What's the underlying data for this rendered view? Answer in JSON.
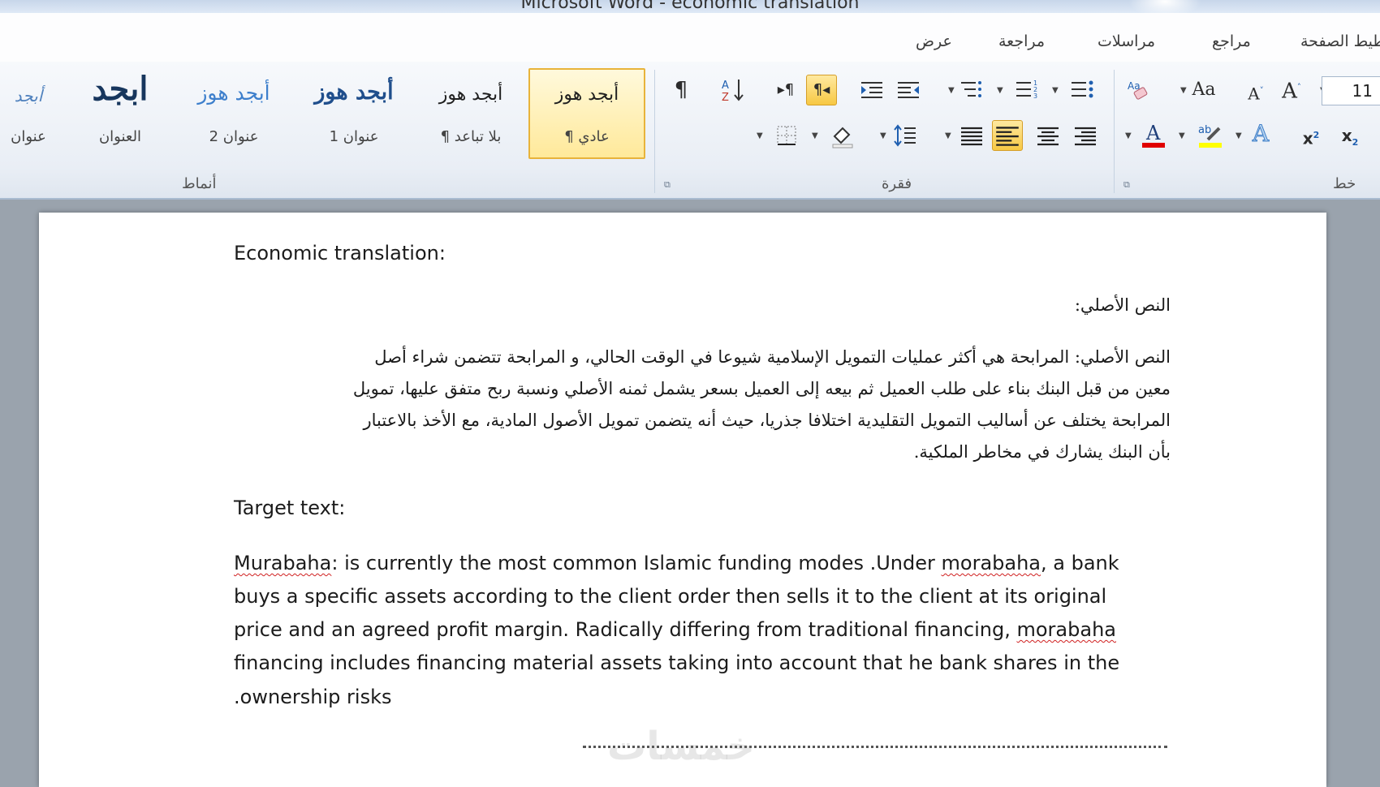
{
  "window": {
    "title": "Microsoft Word  -  economic translation"
  },
  "tabs": [
    "عرض",
    "مراجعة",
    "مراسلات",
    "مراجع",
    "تخطيط الصفحة"
  ],
  "ribbon": {
    "styles_group": {
      "label": "أنماط",
      "tiles": [
        {
          "sample": "أبجد هوز",
          "name": "¶ عادي"
        },
        {
          "sample": "أبجد هوز",
          "name": "¶ بلا تباعد"
        },
        {
          "sample": "أبجد هوز",
          "name": "عنوان 1"
        },
        {
          "sample": "أبجد هوز",
          "name": "عنوان 2"
        },
        {
          "sample": "ابجد",
          "name": "العنوان"
        },
        {
          "sample": "أبجد",
          "name": "عنوان"
        }
      ]
    },
    "paragraph_group": {
      "label": "فقرة"
    },
    "font_group": {
      "label": "خط",
      "font_size": "11"
    }
  },
  "document": {
    "heading": "Economic translation:",
    "source_label": "النص الأصلي:",
    "source_lines": [
      "النص الأصلي: المرابحة هي أكثر عمليات التمويل الإسلامية شيوعا في الوقت الحالي، و المرابحة تتضمن شراء أصل",
      "معين من قبل البنك بناء على طلب العميل ثم بيعه إلى العميل بسعر يشمل ثمنه الأصلي ونسبة ربح متفق عليها، تمويل",
      "المرابحة يختلف عن أساليب التمويل التقليدية اختلافا جذريا، حيث أنه يتضمن تمويل الأصول المادية، مع الأخذ بالاعتبار",
      "بأن  البنك يشارك في مخاطر الملكية."
    ],
    "target_label": "Target text:",
    "target_lines": [
      {
        "pre": "",
        "sq": "Murabaha",
        "post": ": is  currently the most common Islamic funding modes .Under ",
        "sq2": "morabaha",
        "post2": ", a bank"
      },
      {
        "pre": "buys a specific assets according to the client  order then sells it to the client at its original",
        "sq": "",
        "post": "",
        "sq2": "",
        "post2": ""
      },
      {
        "pre": "price and an agreed profit margin. Radically  differing from traditional  financing, ",
        "sq": "morabaha",
        "post": "",
        "sq2": "",
        "post2": ""
      },
      {
        "pre": "financing includes financing material assets taking into account that he bank shares in  the",
        "sq": "",
        "post": "",
        "sq2": "",
        "post2": ""
      },
      {
        "pre": ".ownership risks",
        "sq": "",
        "post": "",
        "sq2": "",
        "post2": ""
      }
    ]
  },
  "watermark": "خمسات"
}
